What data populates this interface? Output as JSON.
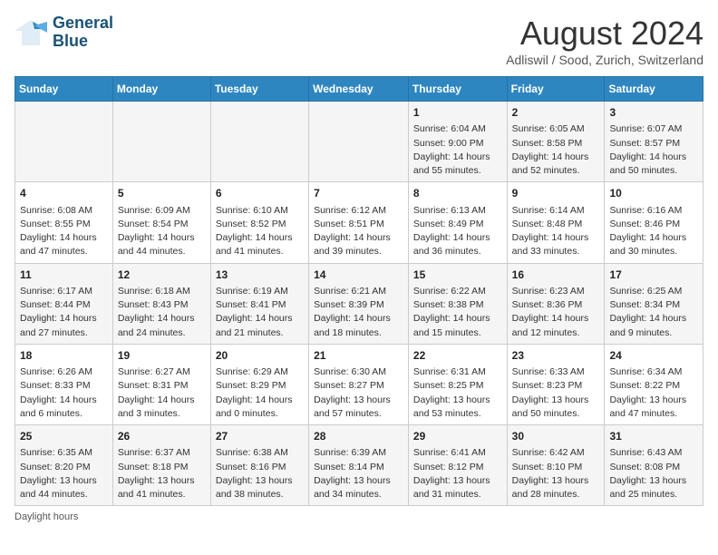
{
  "logo": {
    "line1": "General",
    "line2": "Blue"
  },
  "title": "August 2024",
  "location": "Adliswil / Sood, Zurich, Switzerland",
  "days_of_week": [
    "Sunday",
    "Monday",
    "Tuesday",
    "Wednesday",
    "Thursday",
    "Friday",
    "Saturday"
  ],
  "footer": "Daylight hours",
  "weeks": [
    [
      {
        "day": "",
        "info": ""
      },
      {
        "day": "",
        "info": ""
      },
      {
        "day": "",
        "info": ""
      },
      {
        "day": "",
        "info": ""
      },
      {
        "day": "1",
        "info": "Sunrise: 6:04 AM\nSunset: 9:00 PM\nDaylight: 14 hours\nand 55 minutes."
      },
      {
        "day": "2",
        "info": "Sunrise: 6:05 AM\nSunset: 8:58 PM\nDaylight: 14 hours\nand 52 minutes."
      },
      {
        "day": "3",
        "info": "Sunrise: 6:07 AM\nSunset: 8:57 PM\nDaylight: 14 hours\nand 50 minutes."
      }
    ],
    [
      {
        "day": "4",
        "info": "Sunrise: 6:08 AM\nSunset: 8:55 PM\nDaylight: 14 hours\nand 47 minutes."
      },
      {
        "day": "5",
        "info": "Sunrise: 6:09 AM\nSunset: 8:54 PM\nDaylight: 14 hours\nand 44 minutes."
      },
      {
        "day": "6",
        "info": "Sunrise: 6:10 AM\nSunset: 8:52 PM\nDaylight: 14 hours\nand 41 minutes."
      },
      {
        "day": "7",
        "info": "Sunrise: 6:12 AM\nSunset: 8:51 PM\nDaylight: 14 hours\nand 39 minutes."
      },
      {
        "day": "8",
        "info": "Sunrise: 6:13 AM\nSunset: 8:49 PM\nDaylight: 14 hours\nand 36 minutes."
      },
      {
        "day": "9",
        "info": "Sunrise: 6:14 AM\nSunset: 8:48 PM\nDaylight: 14 hours\nand 33 minutes."
      },
      {
        "day": "10",
        "info": "Sunrise: 6:16 AM\nSunset: 8:46 PM\nDaylight: 14 hours\nand 30 minutes."
      }
    ],
    [
      {
        "day": "11",
        "info": "Sunrise: 6:17 AM\nSunset: 8:44 PM\nDaylight: 14 hours\nand 27 minutes."
      },
      {
        "day": "12",
        "info": "Sunrise: 6:18 AM\nSunset: 8:43 PM\nDaylight: 14 hours\nand 24 minutes."
      },
      {
        "day": "13",
        "info": "Sunrise: 6:19 AM\nSunset: 8:41 PM\nDaylight: 14 hours\nand 21 minutes."
      },
      {
        "day": "14",
        "info": "Sunrise: 6:21 AM\nSunset: 8:39 PM\nDaylight: 14 hours\nand 18 minutes."
      },
      {
        "day": "15",
        "info": "Sunrise: 6:22 AM\nSunset: 8:38 PM\nDaylight: 14 hours\nand 15 minutes."
      },
      {
        "day": "16",
        "info": "Sunrise: 6:23 AM\nSunset: 8:36 PM\nDaylight: 14 hours\nand 12 minutes."
      },
      {
        "day": "17",
        "info": "Sunrise: 6:25 AM\nSunset: 8:34 PM\nDaylight: 14 hours\nand 9 minutes."
      }
    ],
    [
      {
        "day": "18",
        "info": "Sunrise: 6:26 AM\nSunset: 8:33 PM\nDaylight: 14 hours\nand 6 minutes."
      },
      {
        "day": "19",
        "info": "Sunrise: 6:27 AM\nSunset: 8:31 PM\nDaylight: 14 hours\nand 3 minutes."
      },
      {
        "day": "20",
        "info": "Sunrise: 6:29 AM\nSunset: 8:29 PM\nDaylight: 14 hours\nand 0 minutes."
      },
      {
        "day": "21",
        "info": "Sunrise: 6:30 AM\nSunset: 8:27 PM\nDaylight: 13 hours\nand 57 minutes."
      },
      {
        "day": "22",
        "info": "Sunrise: 6:31 AM\nSunset: 8:25 PM\nDaylight: 13 hours\nand 53 minutes."
      },
      {
        "day": "23",
        "info": "Sunrise: 6:33 AM\nSunset: 8:23 PM\nDaylight: 13 hours\nand 50 minutes."
      },
      {
        "day": "24",
        "info": "Sunrise: 6:34 AM\nSunset: 8:22 PM\nDaylight: 13 hours\nand 47 minutes."
      }
    ],
    [
      {
        "day": "25",
        "info": "Sunrise: 6:35 AM\nSunset: 8:20 PM\nDaylight: 13 hours\nand 44 minutes."
      },
      {
        "day": "26",
        "info": "Sunrise: 6:37 AM\nSunset: 8:18 PM\nDaylight: 13 hours\nand 41 minutes."
      },
      {
        "day": "27",
        "info": "Sunrise: 6:38 AM\nSunset: 8:16 PM\nDaylight: 13 hours\nand 38 minutes."
      },
      {
        "day": "28",
        "info": "Sunrise: 6:39 AM\nSunset: 8:14 PM\nDaylight: 13 hours\nand 34 minutes."
      },
      {
        "day": "29",
        "info": "Sunrise: 6:41 AM\nSunset: 8:12 PM\nDaylight: 13 hours\nand 31 minutes."
      },
      {
        "day": "30",
        "info": "Sunrise: 6:42 AM\nSunset: 8:10 PM\nDaylight: 13 hours\nand 28 minutes."
      },
      {
        "day": "31",
        "info": "Sunrise: 6:43 AM\nSunset: 8:08 PM\nDaylight: 13 hours\nand 25 minutes."
      }
    ]
  ]
}
